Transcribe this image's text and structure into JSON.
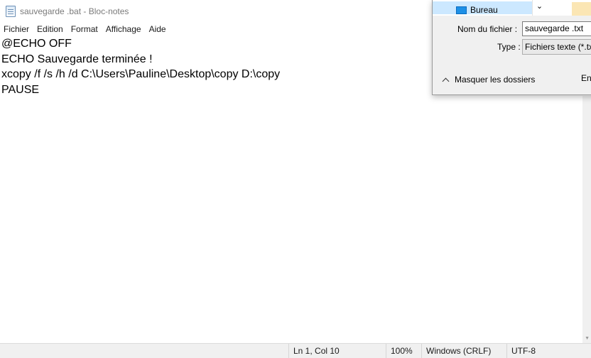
{
  "window": {
    "title": "sauvegarde .bat - Bloc-notes"
  },
  "menu": [
    "Fichier",
    "Edition",
    "Format",
    "Affichage",
    "Aide"
  ],
  "editor": {
    "lines": [
      "@ECHO OFF",
      "ECHO Sauvegarde terminée !",
      "xcopy /f /s /h /d C:\\Users\\Pauline\\Desktop\\copy D:\\copy",
      "PAUSE"
    ]
  },
  "status": {
    "position": "Ln 1, Col 10",
    "zoom": "100%",
    "line_ending": "Windows (CRLF)",
    "encoding": "UTF-8"
  },
  "save_dialog": {
    "folder": {
      "label": "Bureau",
      "icon": "desktop-folder-icon",
      "color": "#1e90e6"
    },
    "filename_label": "Nom du fichier :",
    "filename_value": "sauvegarde .txt",
    "type_label": "Type :",
    "type_value": "Fichiers texte (*.txt)",
    "hide_folders_label": "Masquer les dossiers",
    "save_button_partial": "Enr"
  },
  "colors": {
    "selection": "#cce8ff",
    "statusbar": "#f0f0f0",
    "dialog": "#f0f0f0"
  }
}
